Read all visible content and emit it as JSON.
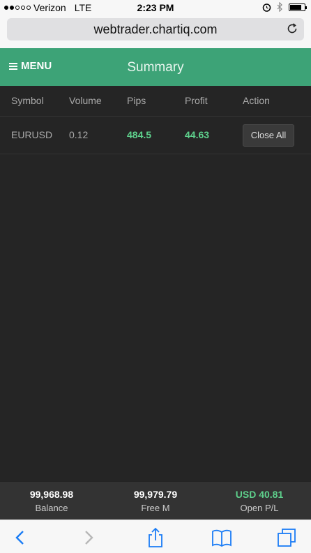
{
  "status_bar": {
    "carrier": "Verizon",
    "network": "LTE",
    "time": "2:23 PM",
    "signal_bars_filled": 2,
    "signal_bars_total": 5,
    "battery_level": 0.8
  },
  "browser": {
    "url": "webtrader.chartiq.com"
  },
  "header": {
    "menu_label": "MENU",
    "title": "Summary",
    "accent_color": "#3da377"
  },
  "table": {
    "columns": [
      "Symbol",
      "Volume",
      "Pips",
      "Profit",
      "Action"
    ],
    "rows": [
      {
        "symbol": "EURUSD",
        "volume": "0.12",
        "pips": "484.5",
        "profit": "44.63",
        "action_label": "Close All"
      }
    ]
  },
  "footer": {
    "balance_value": "99,968.98",
    "balance_label": "Balance",
    "free_margin_value": "99,979.79",
    "free_margin_label": "Free M",
    "open_pl_value": "USD 40.81",
    "open_pl_label": "Open P/L",
    "positive_color": "#5ed08c"
  },
  "toolbar": {
    "icons": [
      "back-icon",
      "forward-icon",
      "share-icon",
      "bookmarks-icon",
      "tabs-icon"
    ]
  }
}
